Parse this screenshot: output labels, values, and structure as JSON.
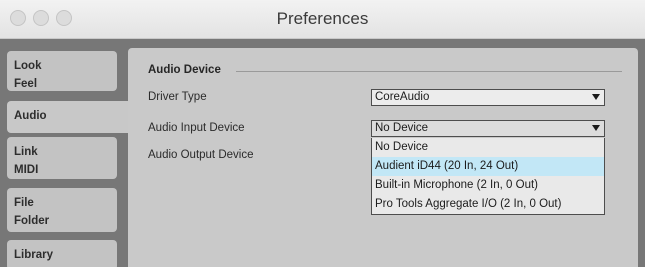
{
  "window": {
    "title": "Preferences"
  },
  "sidebar": {
    "tabs": [
      {
        "lines": [
          "Look",
          "Feel"
        ]
      },
      {
        "lines": [
          "Audio"
        ]
      },
      {
        "lines": [
          "Link",
          "MIDI"
        ]
      },
      {
        "lines": [
          "File",
          "Folder"
        ]
      },
      {
        "lines": [
          "Library"
        ]
      }
    ],
    "active_index": 1
  },
  "audio": {
    "section_title": "Audio Device",
    "driver_type_label": "Driver Type",
    "driver_type_value": "CoreAudio",
    "input_device_label": "Audio Input Device",
    "input_device_value": "No Device",
    "output_device_label": "Audio Output Device",
    "input_device_options": [
      "No Device",
      "Audient iD44 (20 In, 24 Out)",
      "Built-in Microphone (2 In, 0 Out)",
      "Pro Tools Aggregate I/O (2 In, 0 Out)"
    ],
    "highlighted_option_index": 1
  },
  "colors": {
    "menu_highlight": "#c2e7f6",
    "panel_background": "#c9c9c9",
    "window_background": "#777777"
  }
}
